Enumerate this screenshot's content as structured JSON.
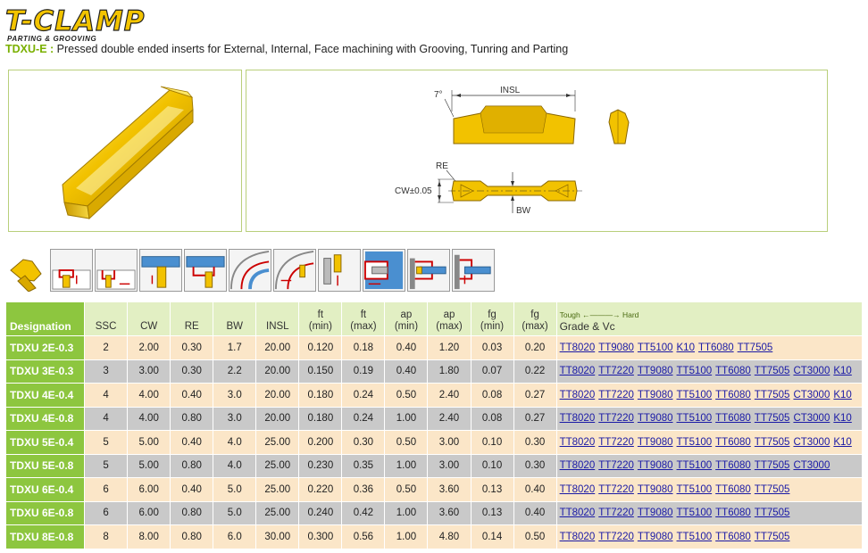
{
  "brand": {
    "logo_text": "T-CLAMP",
    "logo_sub": "PARTING & GROOVING"
  },
  "subtitle": {
    "code": "TDXU-E :",
    "text": " Pressed double ended inserts for External, Internal, Face machining with Grooving, Tunring and Parting"
  },
  "drawing": {
    "angle_label": "7°",
    "insl_label": "INSL",
    "re_label": "RE",
    "cw_label": "CW±0.05",
    "bw_label": "BW"
  },
  "colors": {
    "accent_green": "#8dc63f",
    "header_bg": "#e2efc3",
    "row_odd": "#fbe6c8",
    "row_even": "#c9c9c9",
    "insert_gold": "#f2c200",
    "link": "#1a1aa6"
  },
  "pictograms": [
    "insert-photo-icon",
    "external-grooving-icon",
    "external-profiling-icon",
    "parting-icon",
    "external-turning-icon",
    "face-grooving-icon",
    "face-profiling-icon",
    "internal-grooving-icon",
    "internal-turning-icon",
    "back-grooving-icon",
    "internal-profiling-icon",
    "internal-face-icon"
  ],
  "table": {
    "headers": {
      "designation": "Designation",
      "ssc": "SSC",
      "cw": "CW",
      "re": "RE",
      "bw": "BW",
      "insl": "INSL",
      "ft_min_1": "ft",
      "ft_min_2": "(min)",
      "ft_max_1": "ft",
      "ft_max_2": "(max)",
      "ap_min_1": "ap",
      "ap_min_2": "(min)",
      "ap_max_1": "ap",
      "ap_max_2": "(max)",
      "fg_min_1": "fg",
      "fg_min_2": "(min)",
      "fg_max_1": "fg",
      "fg_max_2": "(max)",
      "grade_scale": "Tough ←———→ Hard",
      "grade_title": "Grade & Vc"
    },
    "rows": [
      {
        "designation": "TDXU 2E-0.3",
        "ssc": "2",
        "cw": "2.00",
        "re": "0.30",
        "bw": "1.7",
        "insl": "20.00",
        "ft_min": "0.120",
        "ft_max": "0.18",
        "ap_min": "0.40",
        "ap_max": "1.20",
        "fg_min": "0.03",
        "fg_max": "0.20",
        "grades": [
          "TT8020",
          "TT9080",
          "TT5100",
          "K10",
          "TT6080",
          "TT7505"
        ]
      },
      {
        "designation": "TDXU 3E-0.3",
        "ssc": "3",
        "cw": "3.00",
        "re": "0.30",
        "bw": "2.2",
        "insl": "20.00",
        "ft_min": "0.150",
        "ft_max": "0.19",
        "ap_min": "0.40",
        "ap_max": "1.80",
        "fg_min": "0.07",
        "fg_max": "0.22",
        "grades": [
          "TT8020",
          "TT7220",
          "TT9080",
          "TT5100",
          "TT6080",
          "TT7505",
          "CT3000",
          "K10"
        ]
      },
      {
        "designation": "TDXU 4E-0.4",
        "ssc": "4",
        "cw": "4.00",
        "re": "0.40",
        "bw": "3.0",
        "insl": "20.00",
        "ft_min": "0.180",
        "ft_max": "0.24",
        "ap_min": "0.50",
        "ap_max": "2.40",
        "fg_min": "0.08",
        "fg_max": "0.27",
        "grades": [
          "TT8020",
          "TT7220",
          "TT9080",
          "TT5100",
          "TT6080",
          "TT7505",
          "CT3000",
          "K10"
        ]
      },
      {
        "designation": "TDXU 4E-0.8",
        "ssc": "4",
        "cw": "4.00",
        "re": "0.80",
        "bw": "3.0",
        "insl": "20.00",
        "ft_min": "0.180",
        "ft_max": "0.24",
        "ap_min": "1.00",
        "ap_max": "2.40",
        "fg_min": "0.08",
        "fg_max": "0.27",
        "grades": [
          "TT8020",
          "TT7220",
          "TT9080",
          "TT5100",
          "TT6080",
          "TT7505",
          "CT3000",
          "K10"
        ]
      },
      {
        "designation": "TDXU 5E-0.4",
        "ssc": "5",
        "cw": "5.00",
        "re": "0.40",
        "bw": "4.0",
        "insl": "25.00",
        "ft_min": "0.200",
        "ft_max": "0.30",
        "ap_min": "0.50",
        "ap_max": "3.00",
        "fg_min": "0.10",
        "fg_max": "0.30",
        "grades": [
          "TT8020",
          "TT7220",
          "TT9080",
          "TT5100",
          "TT6080",
          "TT7505",
          "CT3000",
          "K10"
        ]
      },
      {
        "designation": "TDXU 5E-0.8",
        "ssc": "5",
        "cw": "5.00",
        "re": "0.80",
        "bw": "4.0",
        "insl": "25.00",
        "ft_min": "0.230",
        "ft_max": "0.35",
        "ap_min": "1.00",
        "ap_max": "3.00",
        "fg_min": "0.10",
        "fg_max": "0.30",
        "grades": [
          "TT8020",
          "TT7220",
          "TT9080",
          "TT5100",
          "TT6080",
          "TT7505",
          "CT3000"
        ]
      },
      {
        "designation": "TDXU 6E-0.4",
        "ssc": "6",
        "cw": "6.00",
        "re": "0.40",
        "bw": "5.0",
        "insl": "25.00",
        "ft_min": "0.220",
        "ft_max": "0.36",
        "ap_min": "0.50",
        "ap_max": "3.60",
        "fg_min": "0.13",
        "fg_max": "0.40",
        "grades": [
          "TT8020",
          "TT7220",
          "TT9080",
          "TT5100",
          "TT6080",
          "TT7505"
        ]
      },
      {
        "designation": "TDXU 6E-0.8",
        "ssc": "6",
        "cw": "6.00",
        "re": "0.80",
        "bw": "5.0",
        "insl": "25.00",
        "ft_min": "0.240",
        "ft_max": "0.42",
        "ap_min": "1.00",
        "ap_max": "3.60",
        "fg_min": "0.13",
        "fg_max": "0.40",
        "grades": [
          "TT8020",
          "TT7220",
          "TT9080",
          "TT5100",
          "TT6080",
          "TT7505"
        ]
      },
      {
        "designation": "TDXU 8E-0.8",
        "ssc": "8",
        "cw": "8.00",
        "re": "0.80",
        "bw": "6.0",
        "insl": "30.00",
        "ft_min": "0.300",
        "ft_max": "0.56",
        "ap_min": "1.00",
        "ap_max": "4.80",
        "fg_min": "0.14",
        "fg_max": "0.50",
        "grades": [
          "TT8020",
          "TT7220",
          "TT9080",
          "TT5100",
          "TT6080",
          "TT7505"
        ]
      }
    ]
  }
}
